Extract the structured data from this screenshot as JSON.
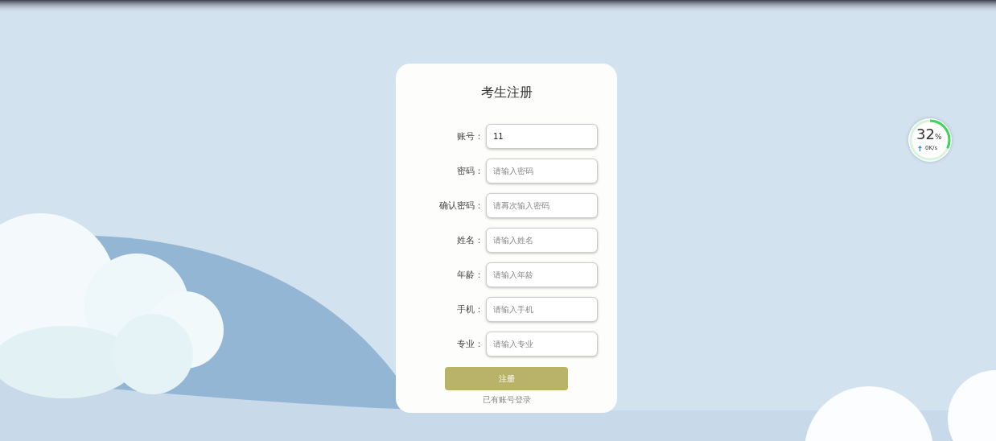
{
  "form": {
    "title": "考生注册",
    "fields": [
      {
        "label": "账号：",
        "value": "11"
      },
      {
        "label": "密码：",
        "placeholder": "请输入密码"
      },
      {
        "label": "确认密码：",
        "placeholder": "请再次输入密码"
      },
      {
        "label": "姓名：",
        "placeholder": "请输入姓名"
      },
      {
        "label": "年龄：",
        "placeholder": "请输入年龄"
      },
      {
        "label": "手机：",
        "placeholder": "请输入手机"
      },
      {
        "label": "专业：",
        "placeholder": "请输入专业"
      }
    ],
    "submit": "注册",
    "login_link": "已有账号登录"
  },
  "speed_widget": {
    "percent": "32",
    "unit": "%",
    "speed": "0K/s",
    "level": 0.32
  }
}
